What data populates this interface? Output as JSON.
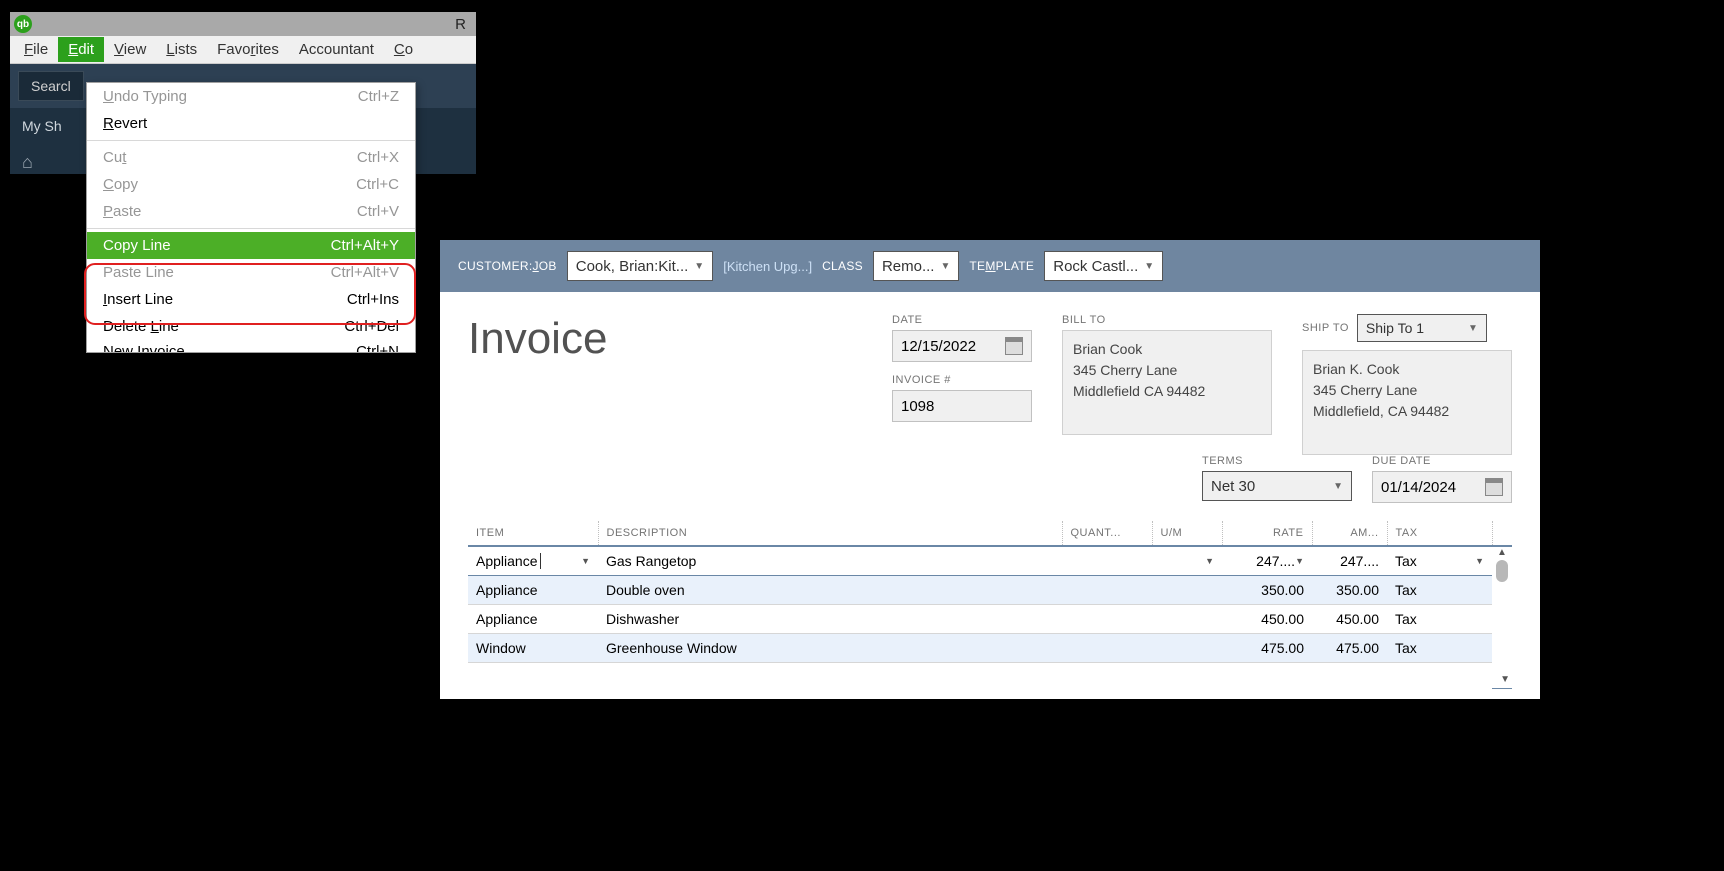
{
  "titlebar": {
    "app_abbrev": "qb",
    "title_partial": "R"
  },
  "menubar": {
    "items": [
      "File",
      "Edit",
      "View",
      "Lists",
      "Favorites",
      "Accountant",
      "Co"
    ],
    "active_index": 1
  },
  "toolbar": {
    "search_label": "Searcl"
  },
  "sidebar": {
    "shortcuts_label": "My Sh"
  },
  "edit_menu": {
    "items": [
      {
        "label": "Undo Typing",
        "shortcut": "Ctrl+Z",
        "disabled": true,
        "u": 0
      },
      {
        "label": "Revert",
        "shortcut": "",
        "disabled": false,
        "u": 0
      },
      {
        "sep": true
      },
      {
        "label": "Cut",
        "shortcut": "Ctrl+X",
        "disabled": true,
        "u": 2
      },
      {
        "label": "Copy",
        "shortcut": "Ctrl+C",
        "disabled": true,
        "u": 0
      },
      {
        "label": "Paste",
        "shortcut": "Ctrl+V",
        "disabled": true,
        "u": 0
      },
      {
        "sep": true
      },
      {
        "label": "Copy Line",
        "shortcut": "Ctrl+Alt+Y",
        "disabled": false,
        "highlight": true
      },
      {
        "label": "Paste Line",
        "shortcut": "Ctrl+Alt+V",
        "disabled": true
      },
      {
        "label": "Insert Line",
        "shortcut": "Ctrl+Ins",
        "disabled": false,
        "u": 0
      },
      {
        "label": "Delete Line",
        "shortcut": "Ctrl+Del",
        "disabled": false,
        "u": 7
      },
      {
        "label": "New Invoice",
        "shortcut": "Ctrl+N",
        "disabled": false,
        "cutoff": true
      }
    ]
  },
  "invoice": {
    "header": {
      "customer_job_label": "CUSTOMER:JOB",
      "customer_job": "Cook, Brian:Kit...",
      "job_link": "[Kitchen Upg...]",
      "class_label": "CLASS",
      "class": "Remo...",
      "template_label": "TEMPLATE",
      "template": "Rock Castl..."
    },
    "title": "Invoice",
    "date_label": "DATE",
    "date": "12/15/2022",
    "invoice_num_label": "INVOICE #",
    "invoice_num": "1098",
    "bill_to_label": "BILL TO",
    "bill_to": "Brian Cook\n345 Cherry Lane\nMiddlefield CA 94482",
    "ship_to_label": "SHIP TO",
    "ship_to_select": "Ship To 1",
    "ship_to": "Brian K. Cook\n345 Cherry Lane\nMiddlefield, CA 94482",
    "terms_label": "TERMS",
    "terms": "Net 30",
    "due_date_label": "DUE DATE",
    "due_date": "01/14/2024",
    "columns": [
      "ITEM",
      "DESCRIPTION",
      "QUANT...",
      "U/M",
      "RATE",
      "AM...",
      "TAX"
    ],
    "rows": [
      {
        "item": "Appliance",
        "desc": "Gas Rangetop",
        "qty": "",
        "um": "",
        "rate": "247....",
        "amount": "247....",
        "tax": "Tax",
        "active": true
      },
      {
        "item": "Appliance",
        "desc": "Double oven",
        "qty": "",
        "um": "",
        "rate": "350.00",
        "amount": "350.00",
        "tax": "Tax"
      },
      {
        "item": "Appliance",
        "desc": "Dishwasher",
        "qty": "",
        "um": "",
        "rate": "450.00",
        "amount": "450.00",
        "tax": "Tax"
      },
      {
        "item": "Window",
        "desc": "Greenhouse Window",
        "qty": "",
        "um": "",
        "rate": "475.00",
        "amount": "475.00",
        "tax": "Tax"
      }
    ]
  }
}
